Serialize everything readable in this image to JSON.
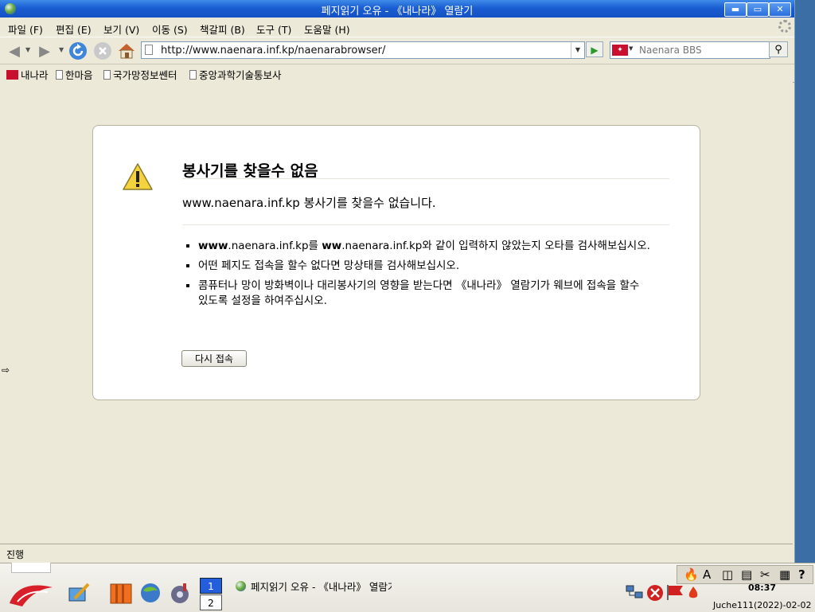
{
  "window": {
    "title": "페지읽기 오유 - 《내나라》 열람기",
    "min_btn": "▬",
    "max_btn": "▭",
    "close_btn": "✕"
  },
  "menu": [
    "파일 (F)",
    "편집 (E)",
    "보기 (V)",
    "이동 (S)",
    "책갈피 (B)",
    "도구 (T)",
    "도움말 (H)"
  ],
  "toolbar": {
    "url": "http://www.naenara.inf.kp/naenarabrowser/",
    "search_placeholder": "Naenara BBS",
    "search_engine_icon": "naenara-flag-icon"
  },
  "bookmarks": [
    "내나라",
    "한마음",
    "국가망정보쎈터",
    "중앙과학기술통보사"
  ],
  "error": {
    "title": "봉사기를 찾을수 없음",
    "host": "www.naenara.inf.kp",
    "desc_rest": " 봉사기를 찾을수 없습니다.",
    "bullets": [
      {
        "b1": "www",
        "t1": ".naenara.inf.kp를 ",
        "b2": "ww",
        "t2": ".naenara.inf.kp와 같이 입력하지 않았는지 오타를 검사해보십시오."
      },
      {
        "t1": "어떤 페지도 접속을 할수 없다면 망상태를 검사해보십시오."
      },
      {
        "t1": "콤퓨터나 망이 방화벽이나 대리봉사기의 영향을 받는다면 《내나라》 열람기가 웨브에 접속을 할수 있도록 설정을 하여주십시오."
      }
    ],
    "retry_label": "다시 접속"
  },
  "status": {
    "text": "진행"
  },
  "taskbar": {
    "workspaces": [
      "1",
      "2"
    ],
    "task_title": "페지읽기 오유 - 《내나라》 열람기",
    "clock": "08:37",
    "date": "Juche111(2022)-02-02",
    "tray_glyphs": [
      "🔥",
      "A",
      "◫",
      "▤",
      "✂",
      "▦",
      "?"
    ]
  }
}
